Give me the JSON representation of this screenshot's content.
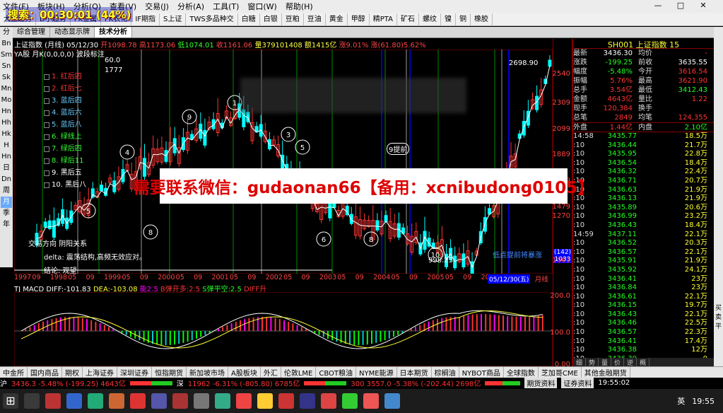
{
  "search_badge": "搜索：00:30:01 (44%)",
  "menu": [
    "文件(F)",
    "板块(H)",
    "分析(Q)",
    "查看(V)",
    "交易(J)",
    "分析(A)",
    "工具(T)",
    "窗口(W)",
    "帮助(H)"
  ],
  "window_controls": [
    "—",
    "□",
    "✕"
  ],
  "toolbar": [
    "大盘趋势",
    "D小趋势",
    "FK金属",
    "FK农化",
    "IF期指",
    "S上证",
    "TWS多品种交",
    "白糖",
    "白银",
    "豆粕",
    "豆油",
    "黄金",
    "甲醇",
    "精PTA",
    "矿石",
    "螺纹",
    "镍",
    "铜",
    "橡胶"
  ],
  "tabs": [
    "综合管理",
    "动态显示牌",
    "技术分析"
  ],
  "active_tab": "技术分析",
  "tab_close": "✕",
  "leftnav": [
    "分",
    "Bn",
    "Sm",
    "Sn",
    "Sk",
    "Mn",
    "Mo",
    "Hn",
    "Hh",
    "Hk",
    "H",
    "Hn",
    "日",
    "Dn",
    "周",
    "月",
    "季",
    "年"
  ],
  "leftnav_selected": "月",
  "chart_info": {
    "name": "上证指数 (月线)",
    "date": "05/12/30",
    "open": "开1098.78",
    "high": "高1173.06",
    "low": "低1074.01",
    "close": "收1161.06",
    "vol": "量379101408",
    "amount": "额1415亿",
    "chg": "涨9.01%",
    "pct": "涨(61.80)5.62%"
  },
  "ya_line": "YA股 月K(0,0,0,0) 波段标注",
  "legend": [
    {
      "label": "1. 红后四",
      "color": "#f33"
    },
    {
      "label": "2. 红后七",
      "color": "#f33"
    },
    {
      "label": "3. 蓝后四",
      "color": "#6cf"
    },
    {
      "label": "4. 蓝后六",
      "color": "#6cf"
    },
    {
      "label": "5. 蓝后八",
      "color": "#6cf"
    },
    {
      "label": "6. 绿线上",
      "color": "#3f3"
    },
    {
      "label": "7. 绿后四",
      "color": "#3f3"
    },
    {
      "label": "8. 绿后11",
      "color": "#3f3"
    },
    {
      "label": "9. 黑后五",
      "color": "#fff"
    },
    {
      "label": "10. 黑后八",
      "color": "#fff"
    }
  ],
  "chart_notes": {
    "n1": "交易方向 阴阳关系",
    "n2": "delta: 震荡结构,高频无效应对。",
    "n3": "结论: 观望",
    "top_label": "2698.90",
    "bottom_label": "998.23",
    "right_note": "低点提前将暴涨",
    "tag_val1": "(142)",
    "tag_val2": "1033",
    "date_tag": "05/12/30(五)",
    "left_val1": "60.0",
    "left_val2": "1777",
    "circle_4ft": "9提前"
  },
  "xaxis": [
    "1997",
    "09",
    "1998",
    "05",
    "09",
    "1999",
    "05",
    "09",
    "2000",
    "05",
    "09",
    "2001",
    "05",
    "09",
    "2002",
    "05",
    "09",
    "2003",
    "05",
    "09",
    "2004",
    "05",
    "09",
    "2005",
    "05",
    "09",
    "2006",
    "05",
    "09",
    "月线"
  ],
  "yaxis": [
    "2540",
    "2309",
    "2099",
    "1889",
    "1679",
    "1479",
    "1270",
    "1061",
    "200.0",
    "100.0",
    "0.00"
  ],
  "macd_info": {
    "name": "TJ MACD",
    "diff": "DIFF:-101.83",
    "dea": "DEA:-103.08",
    "k": "能2.5",
    "buy": "B弹开多:2.5",
    "sell": "S弹平空:2.5",
    "diffup": "DIFF升"
  },
  "right_panel": {
    "title": "SH001  上证指数  15",
    "quotes": [
      [
        "最新",
        "3436.30",
        "均价",
        "-"
      ],
      [
        "涨跌",
        "-199.25",
        "前收",
        "3635.55"
      ],
      [
        "幅度",
        "-5.48%",
        "今开",
        "3616.54"
      ],
      [
        "振幅",
        "5.76%",
        "最高",
        "3621.90"
      ],
      [
        "总手",
        "3.54亿",
        "最低",
        "3412.43"
      ],
      [
        "金额",
        "4643亿",
        "量比",
        "1.22"
      ],
      [
        "现手",
        "120,384",
        "换手",
        ""
      ],
      [
        "总笔",
        "2849",
        "均笔",
        "124,355"
      ]
    ],
    "outer": "外盘",
    "outer_val": "1.44亿",
    "inner": "内盘",
    "inner_val": "2.10亿",
    "ticks": [
      [
        "14:58",
        "3435.77",
        "18.5万"
      ],
      [
        ":10",
        "3436.44",
        "21.7万"
      ],
      [
        ":10",
        "3435.95",
        "22.8万"
      ],
      [
        ":10",
        "3436.54",
        "18.4万"
      ],
      [
        ":10",
        "3436.32",
        "22.4万"
      ],
      [
        ":10",
        "3436.71",
        "20.7万"
      ],
      [
        ":10",
        "3436.63",
        "21.9万"
      ],
      [
        ":10",
        "3436.13",
        "21.9万"
      ],
      [
        ":10",
        "3435.89",
        "20.6万"
      ],
      [
        ":10",
        "3436.99",
        "23.2万"
      ],
      [
        ":10",
        "3436.43",
        "18.4万"
      ],
      [
        "14:59",
        "3437.11",
        "22.1万"
      ],
      [
        ":10",
        "3436.52",
        "20.3万"
      ],
      [
        ":10",
        "3436.57",
        "22.1万"
      ],
      [
        ":10",
        "3435.91",
        "21.9万"
      ],
      [
        ":10",
        "3435.92",
        "24.1万"
      ],
      [
        ":10",
        "3436.41",
        "23万"
      ],
      [
        ":10",
        "3436.84",
        "23万"
      ],
      [
        ":10",
        "3436.61",
        "22.1万"
      ],
      [
        ":10",
        "3436.15",
        "19.7万"
      ],
      [
        ":10",
        "3436.43",
        "22.1万"
      ],
      [
        ":10",
        "3436.46",
        "22.5万"
      ],
      [
        ":10",
        "3436.57",
        "22.3万"
      ],
      [
        ":10",
        "3436.41",
        "17.4万"
      ],
      [
        ":10",
        "3436.38",
        "12万"
      ],
      [
        ":10",
        "3436.30",
        "0"
      ]
    ],
    "tabs": [
      "细",
      "势",
      "量",
      "价",
      "逆",
      "概"
    ]
  },
  "farright": [
    "买",
    "卖",
    "平"
  ],
  "bottom_tabs": [
    "中金所",
    "国内商品",
    "期权",
    "上海证券",
    "深圳证券",
    "恒指期货",
    "新加坡市场",
    "A股板块",
    "外汇",
    "伦敦LME",
    "CBOT粮油",
    "NYME能源",
    "日本期货",
    "棕榈油",
    "NYBOT商品",
    "全球指数",
    "芝加哥CME",
    "其他金融期货"
  ],
  "status": {
    "sh": "沪",
    "sh_v": "3436.3 -5.48% (-199.25) 4643亿",
    "sz": "深",
    "sz_v": "11962 -6.31% (-805.80) 6785亿",
    "c300": "300 3557.0 -5.38% (-202.44) 2698亿",
    "f1": "期货资料",
    "f2": "证券资料",
    "time": "19:55:02"
  },
  "ad_text": "需要联系微信：gudaonan66【备用：xcnibudong0105】",
  "taskbar_time": "19:55",
  "taskbar_lang": "英"
}
